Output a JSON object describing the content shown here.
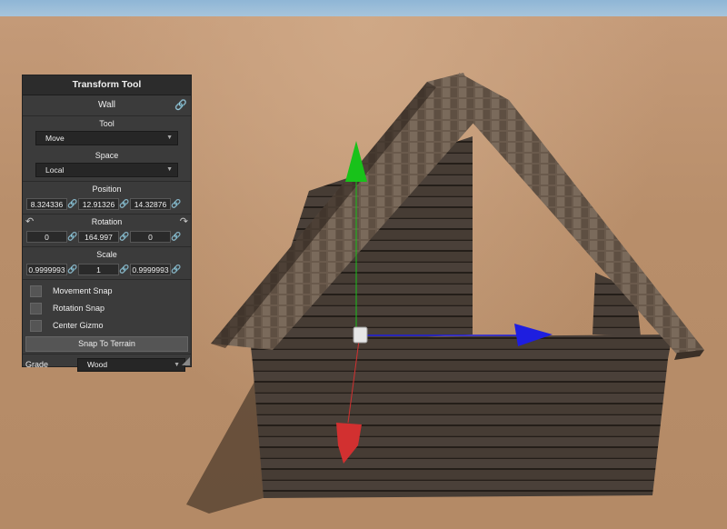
{
  "panel": {
    "title": "Transform Tool",
    "object_name": "Wall",
    "tool_label": "Tool",
    "tool_value": "Move",
    "space_label": "Space",
    "space_value": "Local",
    "position": {
      "label": "Position",
      "x": "8.324336",
      "y": "12.91326",
      "z": "14.32876"
    },
    "rotation": {
      "label": "Rotation",
      "x": "0",
      "y": "164.997",
      "z": "0"
    },
    "scale": {
      "label": "Scale",
      "x": "0.9999993",
      "y": "1",
      "z": "0.9999993"
    },
    "options": [
      "Movement Snap",
      "Rotation Snap",
      "Center Gizmo"
    ],
    "snap_button": "Snap To Terrain",
    "grade_label": "Grade",
    "grade_value": "Wood"
  },
  "gizmo": {
    "x_axis_color": "#1e1ee0",
    "y_axis_color": "#18c21a",
    "z_axis_color": "#d23030"
  },
  "icons": {
    "link": "link-icon",
    "rotate_left": "rotate-left-icon",
    "rotate_right": "rotate-right-icon",
    "dropdown": "chevron-down-icon"
  }
}
